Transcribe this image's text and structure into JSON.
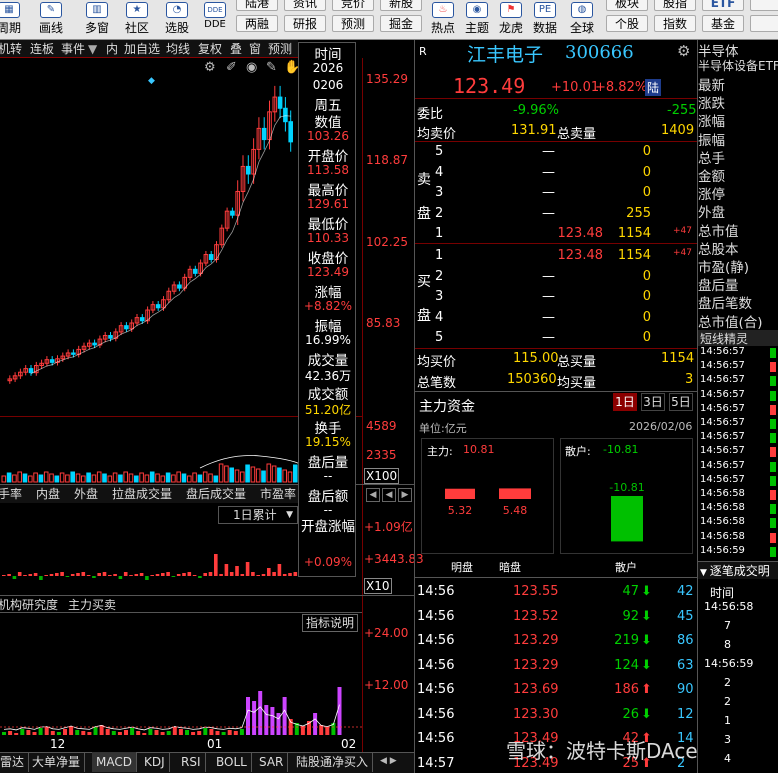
{
  "toolbar": {
    "items": [
      {
        "label": "周期",
        "icon": "calendar-icon"
      },
      {
        "label": "画线",
        "icon": "pen-icon"
      },
      {
        "label": "多窗",
        "icon": "grid-icon"
      },
      {
        "label": "社区",
        "icon": "star-icon"
      },
      {
        "label": "选股",
        "icon": "filter-icon"
      },
      {
        "label": "DDE",
        "icon": "dde-icon"
      }
    ],
    "small_buttons": [
      "陆港",
      "两融",
      "资讯",
      "研报",
      "竞价",
      "预测",
      "新股",
      "掘金"
    ],
    "items_right": [
      {
        "label": "热点",
        "icon": "fire-icon"
      },
      {
        "label": "主题",
        "icon": "theme-icon"
      },
      {
        "label": "龙虎",
        "icon": "tiger-icon"
      },
      {
        "label": "数据",
        "icon": "pe-icon",
        "text": "PE"
      },
      {
        "label": "全球",
        "icon": "globe-icon"
      }
    ],
    "small_buttons_right": [
      "板块",
      "个股",
      "股指",
      "指数",
      "ETF",
      "基金"
    ]
  },
  "tabs": [
    "机转",
    "连板",
    "事件",
    "内",
    "加自选",
    "均线",
    "复权",
    "叠",
    "窗",
    "预测"
  ],
  "chart": {
    "price_ticks": [
      "135.29",
      "118.87",
      "102.25",
      "85.83"
    ],
    "volume_ticks": [
      "4589",
      "2335",
      "X100"
    ],
    "flow_ticks": [
      "+1.09亿",
      "+3443.83",
      "X10"
    ],
    "indicator_ticks": [
      "+24.00",
      "+12.00"
    ],
    "x_labels": [
      "12",
      "01",
      "02"
    ],
    "accum_select": "1日累计",
    "mid_tabs": [
      "手率",
      "内盘",
      "外盘",
      "拉盘成交量",
      "盘后成交量",
      "市盈率"
    ],
    "lower_tabs": [
      "机构研究度",
      "主力买卖"
    ],
    "indicator_btn": "指标说明",
    "candles_close": [
      70.5,
      71.2,
      72.0,
      72.8,
      71.9,
      73.5,
      74.0,
      74.8,
      74.2,
      75.0,
      75.6,
      76.3,
      76.0,
      77.1,
      77.8,
      78.5,
      78.1,
      79.4,
      80.2,
      79.6,
      81.0,
      82.4,
      81.7,
      83.0,
      84.2,
      83.5,
      85.9,
      87.1,
      86.4,
      88.2,
      90.1,
      91.5,
      90.8,
      93.2,
      95.0,
      94.1,
      96.4,
      98.3,
      97.2,
      100.5,
      104.2,
      108.0,
      107.1,
      112.4,
      118.0,
      116.3,
      121.8,
      126.5,
      124.0,
      130.2,
      133.5,
      131.0,
      128.0,
      123.49
    ]
  },
  "info_panel": {
    "time_label": "时间",
    "date1": "2026",
    "date2": "0206",
    "weekday": "周五",
    "value_label": "数值",
    "value": "103.26",
    "open_label": "开盘价",
    "open": "113.58",
    "high_label": "最高价",
    "high": "129.61",
    "low_label": "最低价",
    "low": "110.33",
    "close_label": "收盘价",
    "close": "123.49",
    "chg_label": "涨幅",
    "chg": "+8.82%",
    "amp_label": "振幅",
    "amp": "16.99%",
    "vol_label": "成交量",
    "vol": "42.36万",
    "amt_label": "成交额",
    "amt": "51.20亿",
    "turn_label": "换手",
    "turn": "19.15%",
    "after_vol_label": "盘后量",
    "after_vol": "--",
    "after_amt_label": "盘后额",
    "after_amt": "--",
    "open_chg_label": "开盘涨幅",
    "open_chg": "+0.09%"
  },
  "quote": {
    "r_tag": "R",
    "name": "江丰电子",
    "code": "300666",
    "price": "123.49",
    "chg": "+10.01",
    "chg_pct": "+8.82%",
    "tag": "陆",
    "wb_label": "委比",
    "wb": "-9.96%",
    "wc": "-255",
    "avg_sell_label": "均卖价",
    "avg_sell": "131.91",
    "total_sell_label": "总卖量",
    "total_sell": "1409",
    "sell_label": "卖盘",
    "asks": [
      {
        "lv": "5",
        "price": "—",
        "vol": "0",
        "delta": ""
      },
      {
        "lv": "4",
        "price": "—",
        "vol": "0",
        "delta": ""
      },
      {
        "lv": "3",
        "price": "—",
        "vol": "0",
        "delta": ""
      },
      {
        "lv": "2",
        "price": "—",
        "vol": "255",
        "delta": ""
      },
      {
        "lv": "1",
        "price": "123.48",
        "vol": "1154",
        "delta": "+47"
      }
    ],
    "buy_label": "买盘",
    "bids": [
      {
        "lv": "1",
        "price": "123.48",
        "vol": "1154",
        "delta": "+47"
      },
      {
        "lv": "2",
        "price": "—",
        "vol": "0",
        "delta": ""
      },
      {
        "lv": "3",
        "price": "—",
        "vol": "0",
        "delta": ""
      },
      {
        "lv": "4",
        "price": "—",
        "vol": "0",
        "delta": ""
      },
      {
        "lv": "5",
        "price": "—",
        "vol": "0",
        "delta": ""
      }
    ],
    "avg_buy_label": "均买价",
    "avg_buy": "115.00",
    "total_buy_label": "总买量",
    "total_buy": "1154",
    "total_cnt_label": "总笔数",
    "total_cnt": "150360",
    "avg_buy_vol_label": "均买量",
    "avg_buy_vol": "3"
  },
  "capital": {
    "title": "主力资金",
    "periods": [
      "1日",
      "3日",
      "5日"
    ],
    "unit": "单位:亿元",
    "date": "2026/02/06",
    "main_label": "主力:",
    "main_val": "10.81",
    "retail_label": "散户:",
    "retail_val": "-10.81",
    "bars": [
      {
        "label": "明盘",
        "value": 5.32
      },
      {
        "label": "暗盘",
        "value": 5.48
      },
      {
        "label": "散户",
        "value": -10.81
      }
    ],
    "bar_texts": [
      "5.32",
      "5.48",
      "-10.81"
    ]
  },
  "ticks": [
    {
      "time": "14:56",
      "price": "123.55",
      "vol": "47",
      "dir": "down",
      "n": "42"
    },
    {
      "time": "14:56",
      "price": "123.52",
      "vol": "92",
      "dir": "down",
      "n": "45"
    },
    {
      "time": "14:56",
      "price": "123.29",
      "vol": "219",
      "dir": "down",
      "n": "86"
    },
    {
      "time": "14:56",
      "price": "123.29",
      "vol": "124",
      "dir": "down",
      "n": "63"
    },
    {
      "time": "14:56",
      "price": "123.69",
      "vol": "186",
      "dir": "up",
      "n": "90"
    },
    {
      "time": "14:56",
      "price": "123.30",
      "vol": "26",
      "dir": "down",
      "n": "12"
    },
    {
      "time": "14:56",
      "price": "123.49",
      "vol": "42",
      "dir": "up",
      "n": "14"
    },
    {
      "time": "14:57",
      "price": "123.49",
      "vol": "25",
      "dir": "up",
      "n": "2"
    }
  ],
  "right_panel": {
    "items": [
      "半导体",
      "半导体设备ETF",
      "最新",
      "涨跌",
      "涨幅",
      "振幅",
      "总手",
      "金额",
      "涨停",
      "外盘",
      "总市值",
      "总股本",
      "市盈(静)",
      "盘后量",
      "盘后笔数",
      "总市值(合)"
    ],
    "short_title": "短线精灵",
    "short_times": [
      "14:56:57",
      "14:56:57",
      "14:56:57",
      "14:56:57",
      "14:56:57",
      "14:56:57",
      "14:56:57",
      "14:56:57",
      "14:56:57",
      "14:56:57",
      "14:56:58",
      "14:56:58",
      "14:56:58",
      "14:56:58",
      "14:56:59"
    ],
    "deal_title": "逐笔成交明",
    "deal_head": "时间",
    "deals": [
      "14:56:58",
      "7",
      "8",
      "14:56:59",
      "2",
      "2",
      "1",
      "3",
      "4"
    ]
  },
  "bottom_tabs": [
    "雷达",
    "大单净量",
    "MACD",
    "KDJ",
    "RSI",
    "BOLL",
    "SAR",
    "陆股通净买入"
  ],
  "watermark": "雪球：波特卡斯DAce"
}
